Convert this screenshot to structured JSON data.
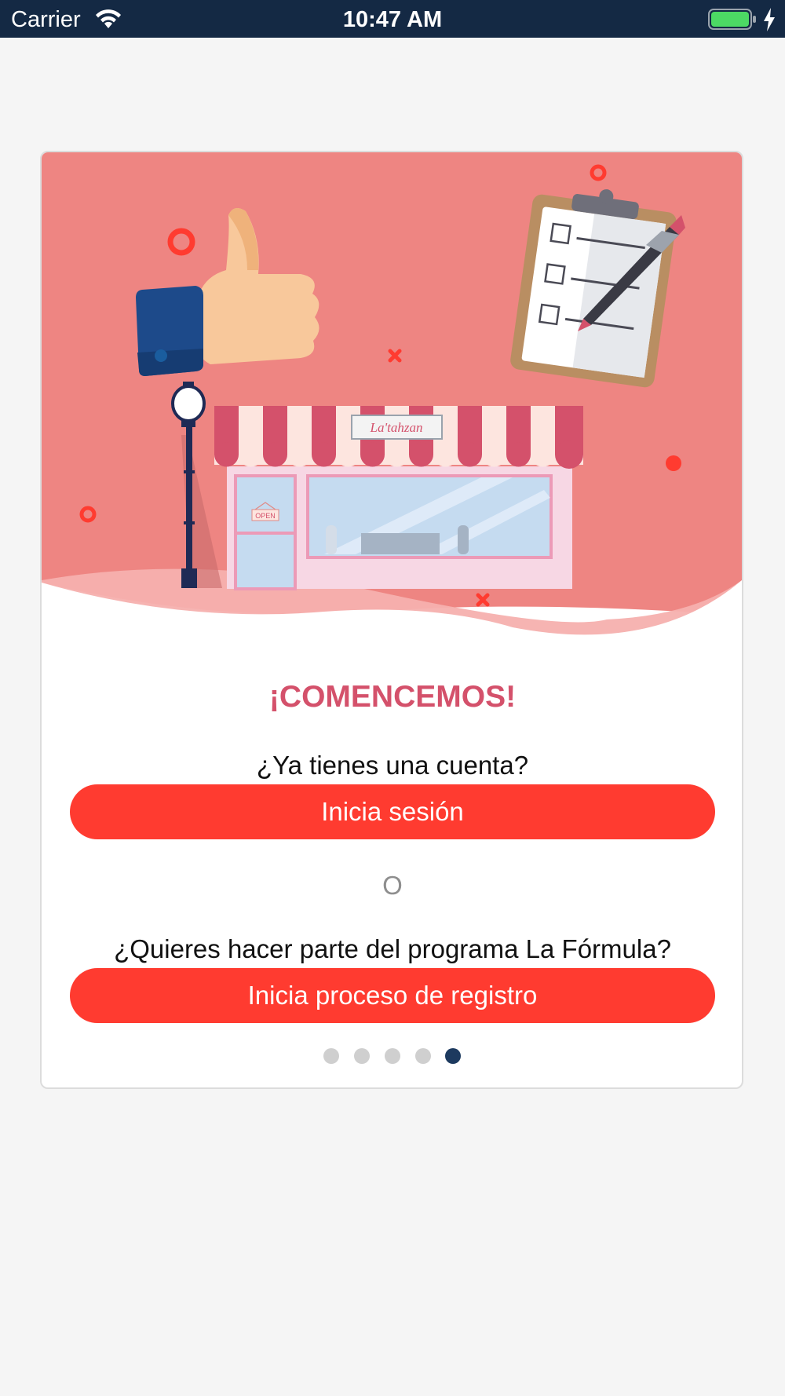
{
  "status_bar": {
    "carrier": "Carrier",
    "time": "10:47 AM",
    "wifi_icon": "wifi-icon",
    "battery_icon": "battery-icon",
    "charging_icon": "charging-bolt-icon"
  },
  "illustration": {
    "store_sign": "La'tahzan",
    "door_sign": "OPEN",
    "icons": [
      "thumbs-up-icon",
      "clipboard-checklist-icon",
      "pen-icon",
      "street-lamp-icon",
      "storefront-icon"
    ]
  },
  "card": {
    "title": "¡COMENCEMOS!",
    "login_question": "¿Ya tienes una cuenta?",
    "login_button": "Inicia sesión",
    "separator": "O",
    "register_question": "¿Quieres hacer parte del programa La Fórmula?",
    "register_button": "Inicia proceso de registro"
  },
  "pagination": {
    "total": 5,
    "current": 5
  },
  "colors": {
    "status_bar": "#142944",
    "illustration_bg": "#ee8582",
    "title": "#d4516b",
    "button": "#ff3b30",
    "dot_active": "#1d3a5f",
    "dot_inactive": "#cfcfcf"
  }
}
